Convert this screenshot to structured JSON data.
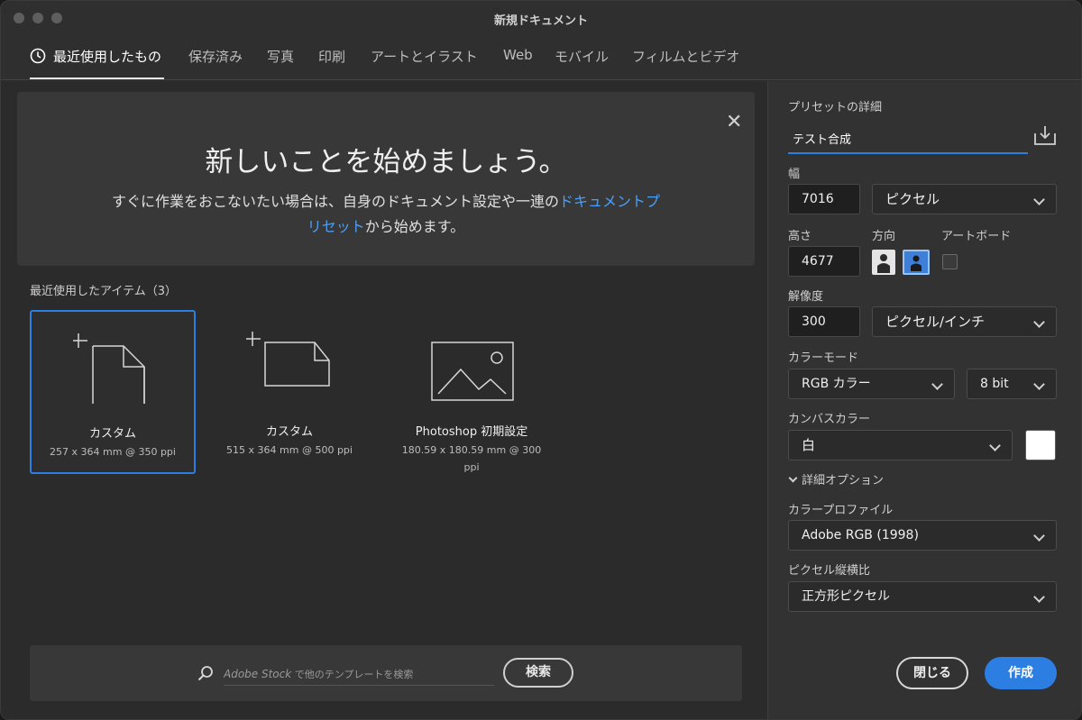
{
  "window": {
    "title": "新規ドキュメント"
  },
  "tabs": [
    {
      "label": "最近使用したもの",
      "active": true
    },
    {
      "label": "保存済み"
    },
    {
      "label": "写真"
    },
    {
      "label": "印刷"
    },
    {
      "label": "アートとイラスト"
    },
    {
      "label": "Web"
    },
    {
      "label": "モバイル"
    },
    {
      "label": "フィルムとビデオ"
    }
  ],
  "welcome": {
    "title": "新しいことを始めましょう。",
    "body_prefix": "すぐに作業をおこないたい場合は、自身のドキュメント設定や一連の",
    "body_link": "ドキュメントプリセット",
    "body_suffix": "から始めます。"
  },
  "recent": {
    "label": "最近使用したアイテム（3）",
    "items": [
      {
        "name": "カスタム",
        "desc": "257 x 364 mm @ 350 ppi",
        "selected": true,
        "icon": "document-icon"
      },
      {
        "name": "カスタム",
        "desc": "515 x 364 mm @ 500 ppi",
        "icon": "document-landscape-icon"
      },
      {
        "name": "Photoshop 初期設定",
        "desc": "180.59 x 180.59 mm @ 300 ppi",
        "icon": "image-icon"
      }
    ]
  },
  "search": {
    "placeholder_brand": "Adobe Stock",
    "placeholder_rest": " で他のテンプレートを検索",
    "button": "検索"
  },
  "preset": {
    "section_label": "プリセットの詳細",
    "name": "テスト合成",
    "width_label": "幅",
    "width_value": "7016",
    "width_unit": "ピクセル",
    "height_label": "高さ",
    "height_value": "4677",
    "orientation_label": "方向",
    "orientation_selected": "landscape",
    "artboard_label": "アートボード",
    "artboard_checked": false,
    "resolution_label": "解像度",
    "resolution_value": "300",
    "resolution_unit": "ピクセル/インチ",
    "color_mode_label": "カラーモード",
    "color_mode": "RGB カラー",
    "bit_depth": "8 bit",
    "canvas_label": "カンバスカラー",
    "canvas_color": "白",
    "canvas_swatch": "#ffffff",
    "advanced_label": "詳細オプション",
    "profile_label": "カラープロファイル",
    "profile": "Adobe RGB (1998)",
    "pixel_aspect_label": "ピクセル縦横比",
    "pixel_aspect": "正方形ピクセル"
  },
  "actions": {
    "close": "閉じる",
    "create": "作成"
  },
  "colors": {
    "accent": "#2d7ee3",
    "link": "#4c9ff5"
  }
}
